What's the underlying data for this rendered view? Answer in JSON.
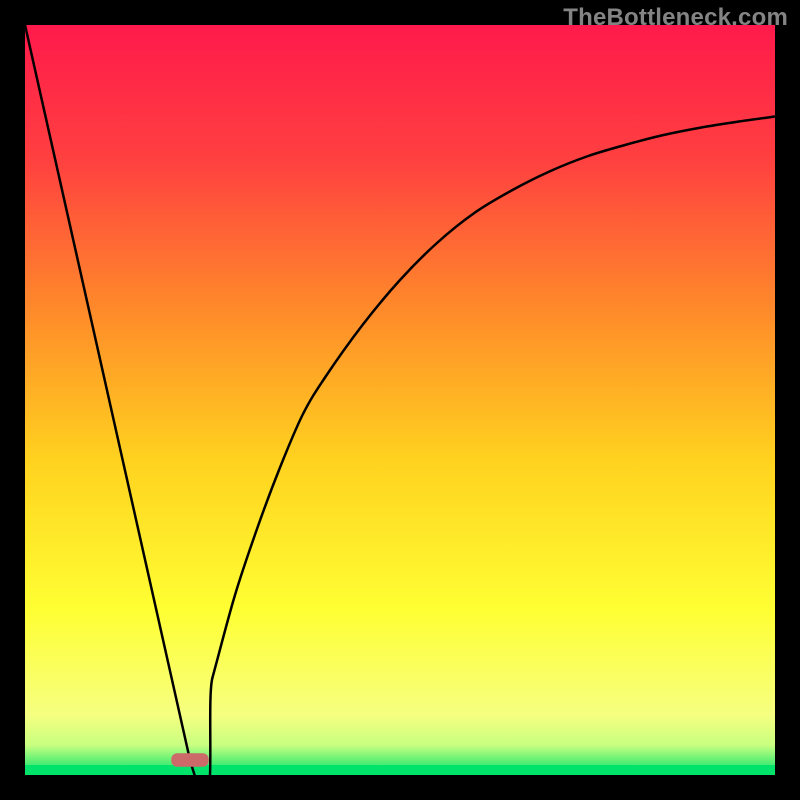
{
  "watermark": "TheBottleneck.com",
  "chart_data": {
    "type": "line",
    "title": "",
    "xlabel": "",
    "ylabel": "",
    "xlim": [
      0,
      100
    ],
    "ylim": [
      0,
      100
    ],
    "grid": false,
    "legend": false,
    "annotations": [],
    "background_gradient": {
      "top": "#ff1a4b",
      "mid_upper": "#ff8a2a",
      "mid": "#ffd21f",
      "mid_lower": "#ffff33",
      "lower": "#f6ff80",
      "bottom_band": "#00e36b"
    },
    "series": [
      {
        "name": "left-descent",
        "type": "line",
        "x": [
          0,
          22
        ],
        "y": [
          100,
          2
        ],
        "note": "straight segment from top-left edge to minimum",
        "stroke": "#000000"
      },
      {
        "name": "right-ascent",
        "type": "curve",
        "x": [
          22,
          25,
          28,
          31,
          34,
          37,
          40,
          45,
          50,
          55,
          60,
          65,
          70,
          75,
          80,
          85,
          90,
          95,
          100
        ],
        "y": [
          2,
          13,
          24,
          33,
          41,
          48,
          53,
          60,
          66,
          71,
          75,
          78,
          80.5,
          82.5,
          84,
          85.3,
          86.3,
          87.1,
          87.8
        ],
        "note": "concave asymptotic rise toward upper-right",
        "stroke": "#000000"
      }
    ],
    "marker": {
      "name": "min-marker",
      "shape": "rounded-bar",
      "x_center": 22,
      "y_center": 2,
      "width_pct": 5,
      "height_pct": 1.8,
      "fill": "#cc6a6a"
    },
    "frame": {
      "border_color": "#000000",
      "border_width_px": 25
    }
  }
}
